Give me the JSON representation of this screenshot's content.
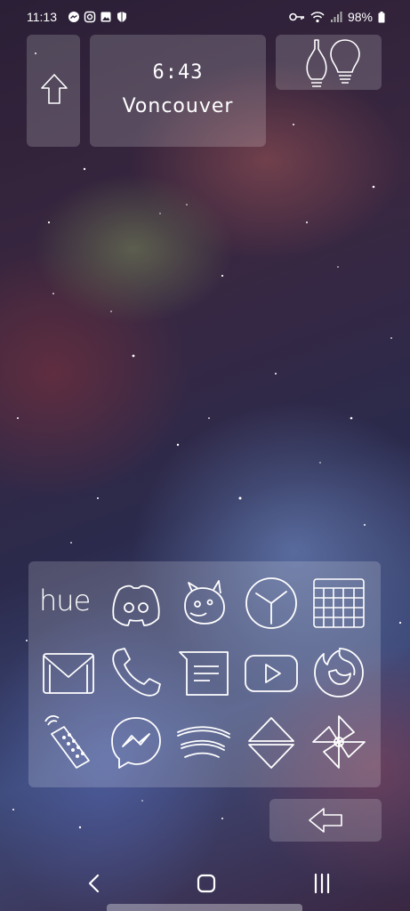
{
  "status_bar": {
    "time": "11:13",
    "battery": "98%",
    "left_icons": [
      "messenger-icon",
      "instagram-icon",
      "gallery-icon",
      "shield-icon"
    ],
    "right_icons": [
      "key-icon",
      "wifi-icon",
      "signal-icon",
      "battery-icon"
    ]
  },
  "widgets": {
    "clock": {
      "time": "6:43",
      "city": "Voncouver"
    },
    "up_button": {
      "icon": "arrow-up-icon"
    },
    "lights": {
      "icon": "lightbulbs-icon"
    },
    "back_button": {
      "icon": "arrow-left-icon"
    }
  },
  "dock": {
    "apps": [
      {
        "name": "hue",
        "label": "hue",
        "icon": "hue-icon"
      },
      {
        "name": "discord",
        "icon": "discord-icon"
      },
      {
        "name": "creature",
        "icon": "creature-icon"
      },
      {
        "name": "clock",
        "icon": "clock-icon"
      },
      {
        "name": "calendar",
        "icon": "calendar-icon"
      },
      {
        "name": "gmail",
        "icon": "mail-icon"
      },
      {
        "name": "phone",
        "icon": "phone-icon"
      },
      {
        "name": "messages",
        "icon": "message-icon"
      },
      {
        "name": "youtube",
        "icon": "play-icon"
      },
      {
        "name": "firefox",
        "icon": "firefox-icon"
      },
      {
        "name": "remote",
        "icon": "remote-icon"
      },
      {
        "name": "messenger",
        "icon": "messenger-icon"
      },
      {
        "name": "spotify",
        "icon": "spotify-icon"
      },
      {
        "name": "triangles",
        "icon": "triangles-icon"
      },
      {
        "name": "pinwheel",
        "icon": "pinwheel-icon"
      }
    ]
  },
  "nav_bar": {
    "buttons": [
      "back",
      "home",
      "recents"
    ]
  }
}
